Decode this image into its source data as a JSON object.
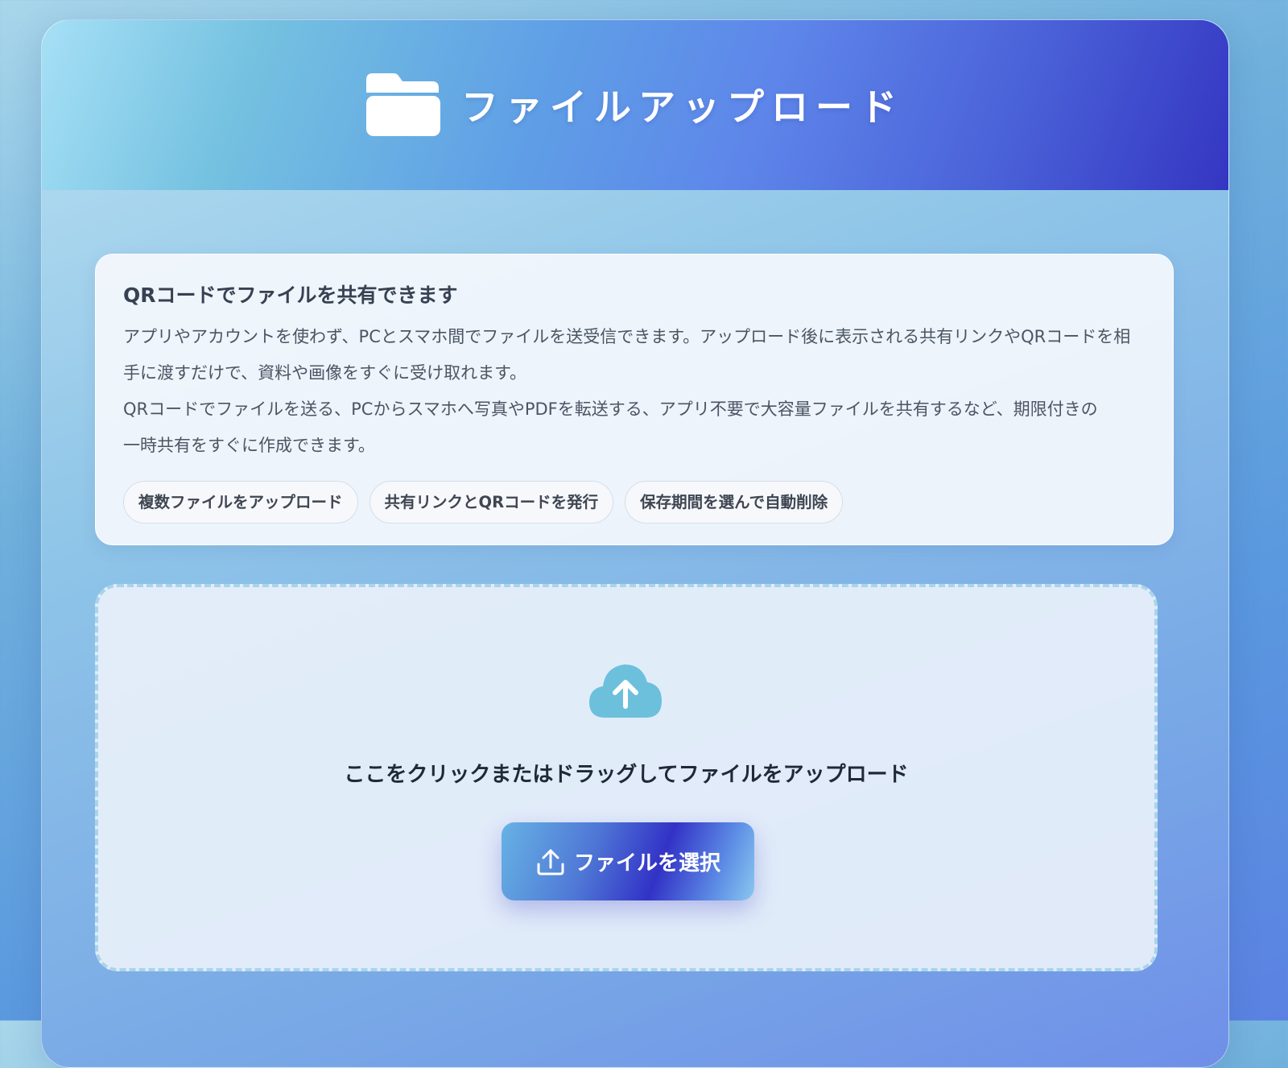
{
  "header": {
    "icon": "folder-icon",
    "title": "ファイルアップロード"
  },
  "info": {
    "title": "QRコードでファイルを共有できます",
    "paragraph_lines": [
      "アプリやアカウントを使わず、PCとスマホ間でファイルを送受信できます。アップロード後に表示される共有リンクやQRコードを相",
      "手に渡すだけで、資料や画像をすぐに受け取れます。",
      "QRコードでファイルを送る、PCからスマホへ写真やPDFを転送する、アプリ不要で大容量ファイルを共有するなど、期限付きの",
      "一時共有をすぐに作成できます。"
    ],
    "chips": [
      "複数ファイルをアップロード",
      "共有リンクとQRコードを発行",
      "保存期間を選んで自動削除"
    ]
  },
  "dropzone": {
    "icon": "cloud-upload-icon",
    "text": "ここをクリックまたはドラッグしてファイルをアップロード",
    "button_icon": "upload-icon",
    "button_label": "ファイルを選択"
  },
  "colors": {
    "header_gradient_start": "#a6e0f6",
    "header_gradient_end": "#3436c2",
    "cloud_icon": "#6cc0dc",
    "button_gradient_mid": "#3232c6"
  }
}
